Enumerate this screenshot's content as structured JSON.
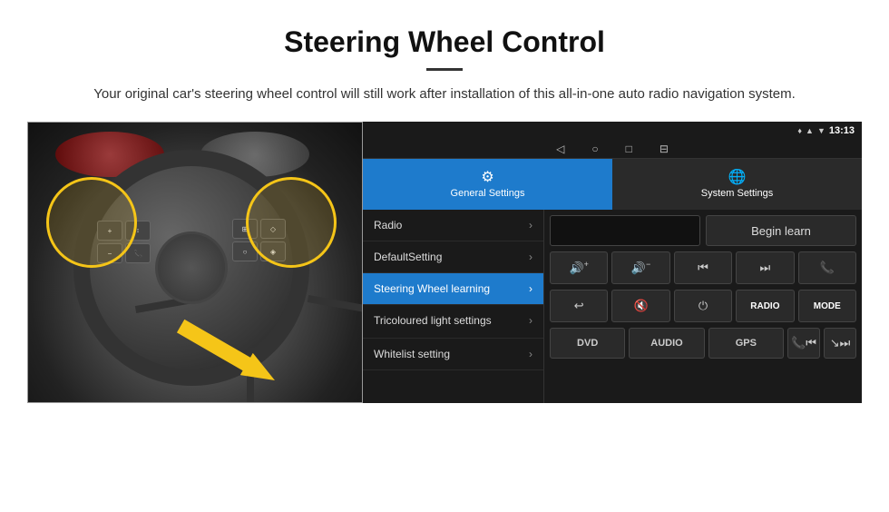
{
  "header": {
    "title": "Steering Wheel Control",
    "subtitle": "Your original car's steering wheel control will still work after installation of this all-in-one auto radio navigation system."
  },
  "android": {
    "status_bar": {
      "time": "13:13",
      "signal_icon": "▲",
      "wifi_icon": "▼",
      "location_icon": "♦"
    },
    "nav_buttons": [
      "◁",
      "○",
      "□",
      "⊟"
    ],
    "tabs": [
      {
        "id": "general",
        "label": "General Settings",
        "icon": "⚙",
        "active": true
      },
      {
        "id": "system",
        "label": "System Settings",
        "icon": "🌐",
        "active": false
      }
    ],
    "menu_items": [
      {
        "label": "Radio",
        "active": false
      },
      {
        "label": "DefaultSetting",
        "active": false
      },
      {
        "label": "Steering Wheel learning",
        "active": true
      },
      {
        "label": "Tricoloured light settings",
        "active": false
      },
      {
        "label": "Whitelist setting",
        "active": false
      }
    ],
    "begin_learn_label": "Begin learn",
    "control_buttons": [
      {
        "icon": "🔊+",
        "label": "vol-up"
      },
      {
        "icon": "🔊-",
        "label": "vol-down"
      },
      {
        "icon": "⏮",
        "label": "prev"
      },
      {
        "icon": "⏭",
        "label": "next"
      },
      {
        "icon": "📞",
        "label": "call"
      },
      {
        "icon": "↩",
        "label": "back"
      },
      {
        "icon": "🔇",
        "label": "mute"
      },
      {
        "icon": "⏻",
        "label": "power"
      },
      {
        "icon": "RADIO",
        "label": "radio"
      },
      {
        "icon": "MODE",
        "label": "mode"
      },
      {
        "icon": "DVD",
        "label": "dvd"
      },
      {
        "icon": "AUDIO",
        "label": "audio"
      },
      {
        "icon": "GPS",
        "label": "gps"
      },
      {
        "icon": "📞⏮",
        "label": "call-prev"
      },
      {
        "icon": "↘⏭",
        "label": "skip"
      }
    ]
  }
}
